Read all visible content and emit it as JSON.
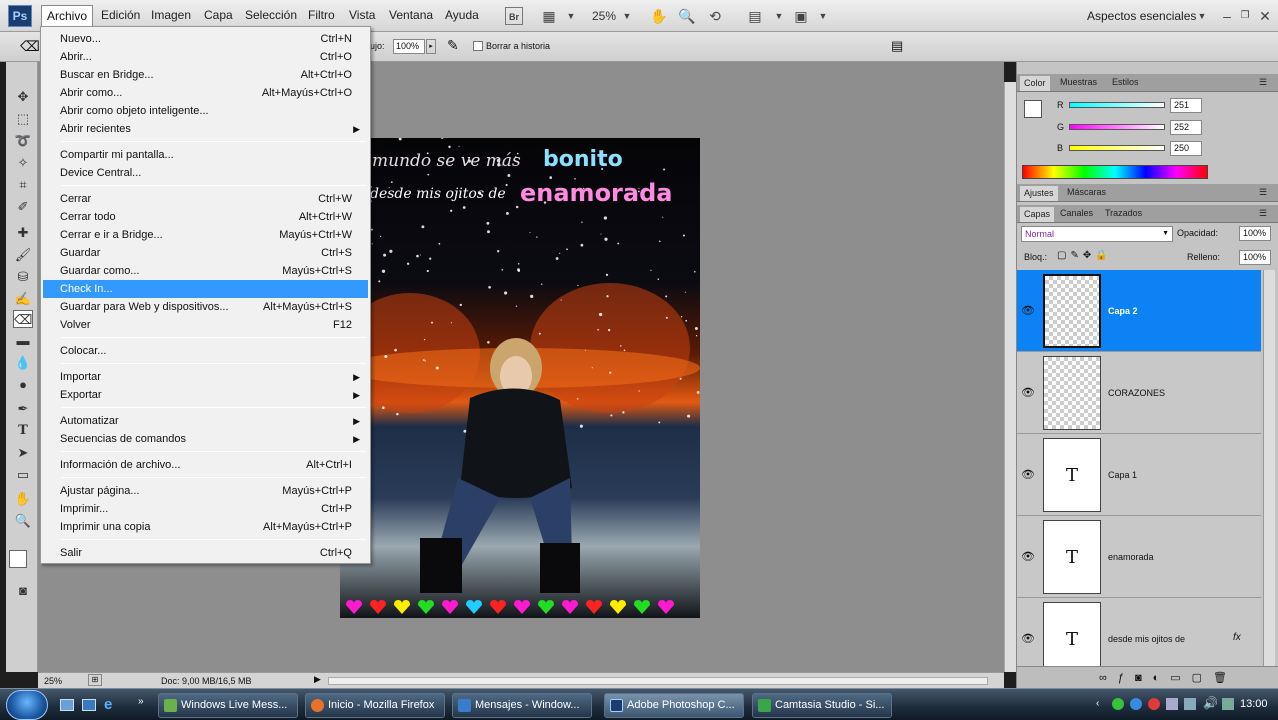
{
  "app": {
    "logo": "Ps"
  },
  "menubar": {
    "items": [
      "Archivo",
      "Edición",
      "Imagen",
      "Capa",
      "Selección",
      "Filtro",
      "Vista",
      "Ventana",
      "Ayuda"
    ],
    "bridge": "Br",
    "zoom": "25%",
    "workspace": "Aspectos esenciales"
  },
  "options": {
    "flow_label": "ujo:",
    "flow_value": "100%",
    "erase_history": "Borrar a historia"
  },
  "archivo_menu": [
    {
      "label": "Nuevo...",
      "shortcut": "Ctrl+N"
    },
    {
      "label": "Abrir...",
      "shortcut": "Ctrl+O"
    },
    {
      "label": "Buscar en Bridge...",
      "shortcut": "Alt+Ctrl+O"
    },
    {
      "label": "Abrir como...",
      "shortcut": "Alt+Mayús+Ctrl+O"
    },
    {
      "label": "Abrir como objeto inteligente...",
      "shortcut": ""
    },
    {
      "label": "Abrir recientes",
      "shortcut": "",
      "submenu": true
    },
    {
      "label": "Compartir mi pantalla...",
      "shortcut": ""
    },
    {
      "label": "Device Central...",
      "shortcut": ""
    },
    {
      "label": "Cerrar",
      "shortcut": "Ctrl+W"
    },
    {
      "label": "Cerrar todo",
      "shortcut": "Alt+Ctrl+W"
    },
    {
      "label": "Cerrar e ir a Bridge...",
      "shortcut": "Mayús+Ctrl+W"
    },
    {
      "label": "Guardar",
      "shortcut": "Ctrl+S"
    },
    {
      "label": "Guardar como...",
      "shortcut": "Mayús+Ctrl+S"
    },
    {
      "label": "Check In...",
      "shortcut": "",
      "highlighted": true
    },
    {
      "label": "Guardar para Web y dispositivos...",
      "shortcut": "Alt+Mayús+Ctrl+S"
    },
    {
      "label": "Volver",
      "shortcut": "F12"
    },
    {
      "label": "Colocar...",
      "shortcut": ""
    },
    {
      "label": "Importar",
      "shortcut": "",
      "submenu": true
    },
    {
      "label": "Exportar",
      "shortcut": "",
      "submenu": true
    },
    {
      "label": "Automatizar",
      "shortcut": "",
      "submenu": true
    },
    {
      "label": "Secuencias de comandos",
      "shortcut": "",
      "submenu": true
    },
    {
      "label": "Información de archivo...",
      "shortcut": "Alt+Ctrl+I"
    },
    {
      "label": "Ajustar página...",
      "shortcut": "Mayús+Ctrl+P"
    },
    {
      "label": "Imprimir...",
      "shortcut": "Ctrl+P"
    },
    {
      "label": "Imprimir una copia",
      "shortcut": "Alt+Mayús+Ctrl+P"
    },
    {
      "label": "Salir",
      "shortcut": "Ctrl+Q"
    }
  ],
  "canvas": {
    "line1_a": "mundo se ve más",
    "line1_b": "bonito",
    "line2_a": "desde mis ojitos de",
    "line2_b": "enamorada"
  },
  "status": {
    "zoom": "25%",
    "doc": "Doc: 9,00 MB/16,5 MB"
  },
  "color_panel": {
    "tabs": [
      "Color",
      "Muestras",
      "Estilos"
    ],
    "channels": [
      {
        "name": "R",
        "value": "251"
      },
      {
        "name": "G",
        "value": "252"
      },
      {
        "name": "B",
        "value": "250"
      }
    ]
  },
  "adjust_panel": {
    "tabs": [
      "Ajustes",
      "Máscaras"
    ]
  },
  "layers_panel": {
    "tabs": [
      "Capas",
      "Canales",
      "Trazados"
    ],
    "blend": "Normal",
    "opacity_label": "Opacidad:",
    "opacity": "100%",
    "lock_label": "Bloq.:",
    "fill_label": "Relleno:",
    "fill": "100%",
    "layers": [
      {
        "name": "Capa 2",
        "type": "raster"
      },
      {
        "name": "CORAZONES",
        "type": "raster"
      },
      {
        "name": "Capa 1",
        "type": "text"
      },
      {
        "name": "enamorada",
        "type": "text"
      },
      {
        "name": "desde mis ojitos de",
        "type": "text"
      }
    ]
  },
  "taskbar": {
    "tasks": [
      "Windows Live Mess...",
      "Inicio - Mozilla Firefox",
      "Mensajes - Window...",
      "Adobe Photoshop C...",
      "Camtasia Studio - Si..."
    ],
    "clock": "13:00"
  },
  "colors": {
    "selection": "#0d82f5",
    "menu_highlight": "#3399ff"
  }
}
